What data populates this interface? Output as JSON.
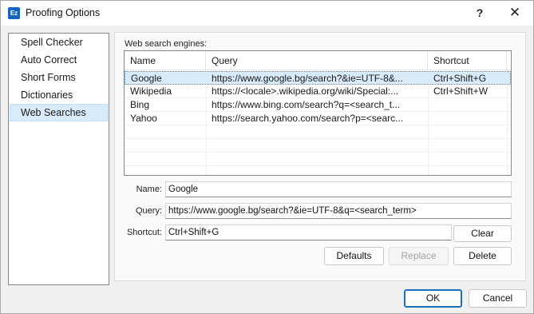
{
  "window": {
    "title": "Proofing Options",
    "app_icon_text": "Ez"
  },
  "titlebar": {
    "help_label": "?",
    "close_label": "✕"
  },
  "sidebar": {
    "items": [
      {
        "label": "Spell Checker"
      },
      {
        "label": "Auto Correct"
      },
      {
        "label": "Short Forms"
      },
      {
        "label": "Dictionaries"
      },
      {
        "label": "Web Searches",
        "selected": true
      }
    ]
  },
  "web_search": {
    "group_label": "Web search engines:",
    "columns": [
      "Name",
      "Query",
      "Shortcut"
    ],
    "rows": [
      {
        "name": "Google",
        "query": "https://www.google.bg/search?&ie=UTF-8&...",
        "shortcut": "Ctrl+Shift+G"
      },
      {
        "name": "Wikipedia",
        "query": "https://<locale>.wikipedia.org/wiki/Special:...",
        "shortcut": "Ctrl+Shift+W"
      },
      {
        "name": "Bing",
        "query": "https://www.bing.com/search?q=<search_t...",
        "shortcut": ""
      },
      {
        "name": "Yahoo",
        "query": "https://search.yahoo.com/search?p=<searc...",
        "shortcut": ""
      }
    ]
  },
  "form": {
    "name_label": "Name:",
    "name_value": "Google",
    "query_label": "Query:",
    "query_value": "https://www.google.bg/search?&ie=UTF-8&q=<search_term>",
    "shortcut_label": "Shortcut:",
    "shortcut_value": "Ctrl+Shift+G",
    "clear_label": "Clear",
    "defaults_label": "Defaults",
    "replace_label": "Replace",
    "delete_label": "Delete"
  },
  "footer": {
    "ok_label": "OK",
    "cancel_label": "Cancel"
  }
}
